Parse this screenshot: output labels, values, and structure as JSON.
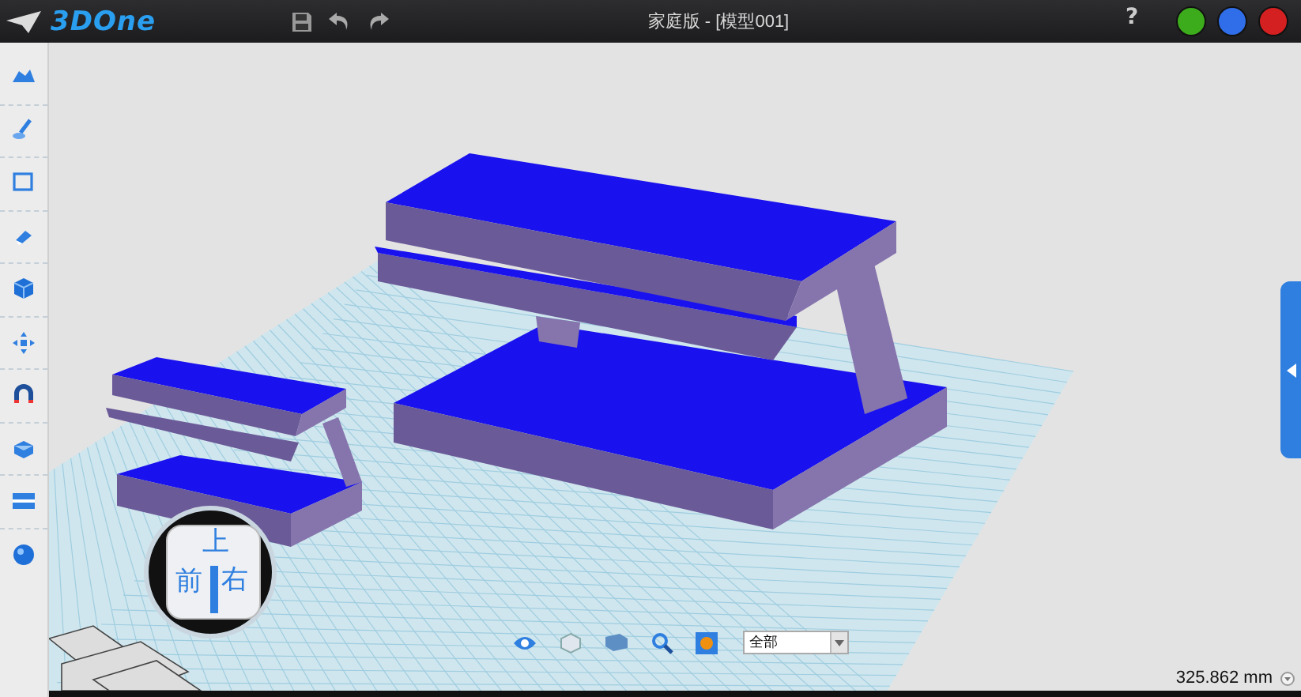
{
  "window": {
    "logo_text": "3DOne",
    "title": "家庭版 - [模型001]",
    "help": "?"
  },
  "view_cube": {
    "top": "上",
    "front": "前",
    "right": "右"
  },
  "bottom_toolbar": {
    "filter": {
      "value": "全部"
    }
  },
  "status_bar": {
    "distance": "325.862 mm"
  }
}
